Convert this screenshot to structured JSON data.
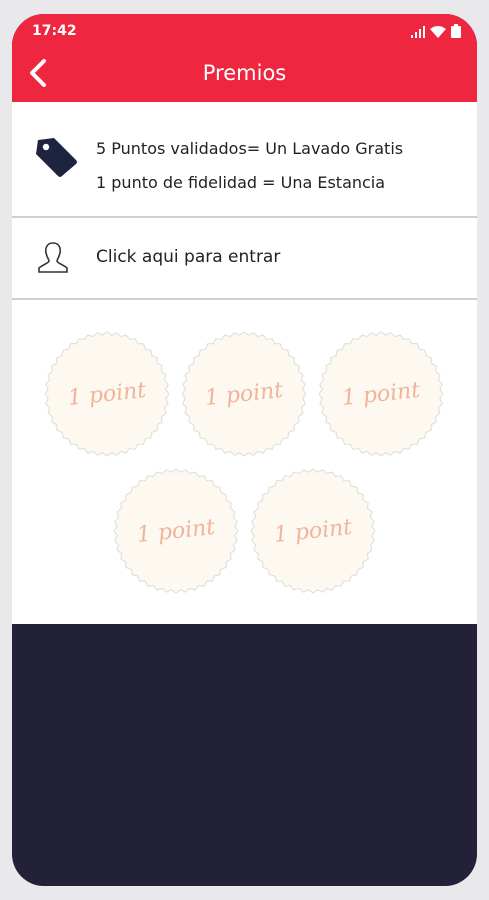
{
  "status_bar": {
    "time": "17:42"
  },
  "toolbar": {
    "title": "Premios",
    "back_icon": "chevron-left-icon"
  },
  "colors": {
    "accent": "#ee2640",
    "footer": "#23213a",
    "stamp_text": "#f1b39a"
  },
  "rewards": {
    "icon": "price-tag-icon",
    "lines": [
      "5 Puntos validados= Un Lavado Gratis",
      "1 punto de fidelidad = Una Estancia"
    ]
  },
  "login": {
    "icon": "user-outline-icon",
    "label": "Click aqui para entrar"
  },
  "stamps": [
    {
      "label": "1 point"
    },
    {
      "label": "1 point"
    },
    {
      "label": "1 point"
    },
    {
      "label": "1 point"
    },
    {
      "label": "1 point"
    }
  ]
}
